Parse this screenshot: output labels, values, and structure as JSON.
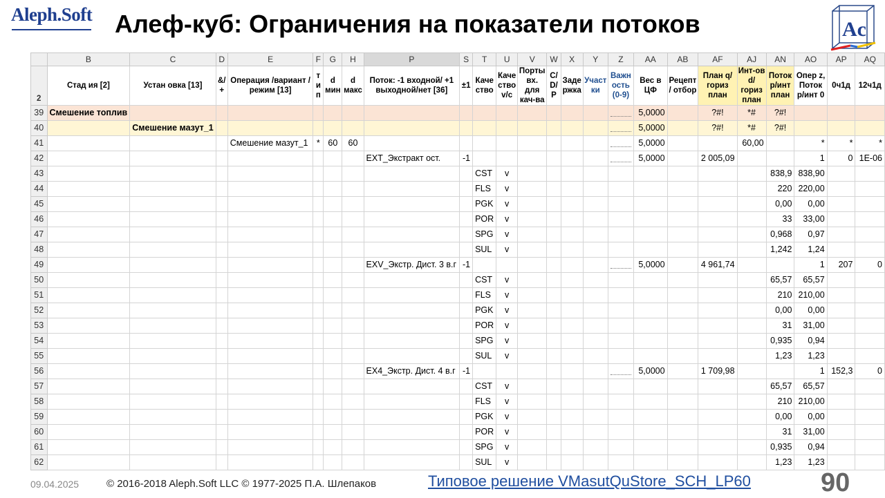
{
  "header": {
    "logo": "Aleph.Soft",
    "title": "Алеф-куб: Ограничения на показатели потоков",
    "cube_logo": "Ac"
  },
  "columns": [
    "B",
    "C",
    "D",
    "E",
    "F",
    "G",
    "H",
    "P",
    "S",
    "T",
    "U",
    "V",
    "W",
    "X",
    "Y",
    "Z",
    "AA",
    "AB",
    "AF",
    "AJ",
    "AN",
    "AO",
    "AP",
    "AQ"
  ],
  "header_row": {
    "rownum": "2",
    "cells": [
      "Стад ия [2]",
      "Устан овка [13]",
      "&/ +",
      "Операция /вариант /режим [13]",
      "т и п",
      "d мин",
      "d макс",
      "Поток: -1 входной/ +1 выходной/нет [36]",
      "±1",
      "Каче ство",
      "Каче ство v/c",
      "Порты вх. для кач-ва",
      "C/ D/ P",
      "Заде ржка",
      "Участ ки",
      "Важн ость (0-9)",
      "Вес в ЦФ",
      "Рецепт / отбор",
      "План q/гориз план",
      "Инт-ов d/гориз план",
      "Поток р/инт план",
      "Опер z, Поток р/инт 0",
      "0ч1д",
      "12ч1д"
    ]
  },
  "rows": [
    {
      "n": "39",
      "cls": "r39",
      "B": "Смешение топлив",
      "Z": "dots",
      "AA": "5,0000",
      "AF": "?#!",
      "AJ": "*#",
      "AN": "?#!"
    },
    {
      "n": "40",
      "cls": "r40",
      "C": "Смешение мазут_1",
      "Z": "dots",
      "AA": "5,0000",
      "AF": "?#!",
      "AJ": "*#",
      "AN": "?#!"
    },
    {
      "n": "41",
      "E": "Смешение мазут_1",
      "F": "*",
      "G": "60",
      "H": "60",
      "Z": "dots",
      "AA": "5,0000",
      "AJ": "60,00",
      "AO": "*",
      "AP": "*",
      "AQ": "*"
    },
    {
      "n": "42",
      "P": "EXT_Экстракт ост.",
      "S": "-1",
      "Z": "dots",
      "AA": "5,0000",
      "AF": "2 005,09",
      "AO": "1",
      "AP": "0",
      "AQ": "1E-06"
    },
    {
      "n": "43",
      "T": "CST",
      "U": "v",
      "AN": "838,9",
      "AO": "838,90"
    },
    {
      "n": "44",
      "T": "FLS",
      "U": "v",
      "AN": "220",
      "AO": "220,00"
    },
    {
      "n": "45",
      "T": "PGK",
      "U": "v",
      "AN": "0,00",
      "AO": "0,00"
    },
    {
      "n": "46",
      "T": "POR",
      "U": "v",
      "AN": "33",
      "AO": "33,00"
    },
    {
      "n": "47",
      "T": "SPG",
      "U": "v",
      "AN": "0,968",
      "AO": "0,97"
    },
    {
      "n": "48",
      "T": "SUL",
      "U": "v",
      "AN": "1,242",
      "AO": "1,24"
    },
    {
      "n": "49",
      "P": "EXV_Экстр. Дист. 3 в.г",
      "S": "-1",
      "Z": "dots",
      "AA": "5,0000",
      "AF": "4 961,74",
      "AO": "1",
      "AP": "207",
      "AQ": "0"
    },
    {
      "n": "50",
      "T": "CST",
      "U": "v",
      "AN": "65,57",
      "AO": "65,57"
    },
    {
      "n": "51",
      "T": "FLS",
      "U": "v",
      "AN": "210",
      "AO": "210,00"
    },
    {
      "n": "52",
      "T": "PGK",
      "U": "v",
      "AN": "0,00",
      "AO": "0,00"
    },
    {
      "n": "53",
      "T": "POR",
      "U": "v",
      "AN": "31",
      "AO": "31,00"
    },
    {
      "n": "54",
      "T": "SPG",
      "U": "v",
      "AN": "0,935",
      "AO": "0,94"
    },
    {
      "n": "55",
      "T": "SUL",
      "U": "v",
      "AN": "1,23",
      "AO": "1,23"
    },
    {
      "n": "56",
      "P": "EX4_Экстр. Дист. 4 в.г",
      "S": "-1",
      "Z": "dots",
      "AA": "5,0000",
      "AF": "1 709,98",
      "AO": "1",
      "AP": "152,3",
      "AQ": "0"
    },
    {
      "n": "57",
      "T": "CST",
      "U": "v",
      "AN": "65,57",
      "AO": "65,57"
    },
    {
      "n": "58",
      "T": "FLS",
      "U": "v",
      "AN": "210",
      "AO": "210,00"
    },
    {
      "n": "59",
      "T": "PGK",
      "U": "v",
      "AN": "0,00",
      "AO": "0,00"
    },
    {
      "n": "60",
      "T": "POR",
      "U": "v",
      "AN": "31",
      "AO": "31,00"
    },
    {
      "n": "61",
      "T": "SPG",
      "U": "v",
      "AN": "0,935",
      "AO": "0,94"
    },
    {
      "n": "62",
      "T": "SUL",
      "U": "v",
      "AN": "1,23",
      "AO": "1,23"
    }
  ],
  "footer": {
    "date": "09.04.2025",
    "copyright": "© 2016-2018 Aleph.Soft LLC © 1977-2025 П.А. Шлепаков",
    "link1": "Типовое решение",
    "link2": "VMasutQuStore_SCH_LP60",
    "page": "90"
  }
}
